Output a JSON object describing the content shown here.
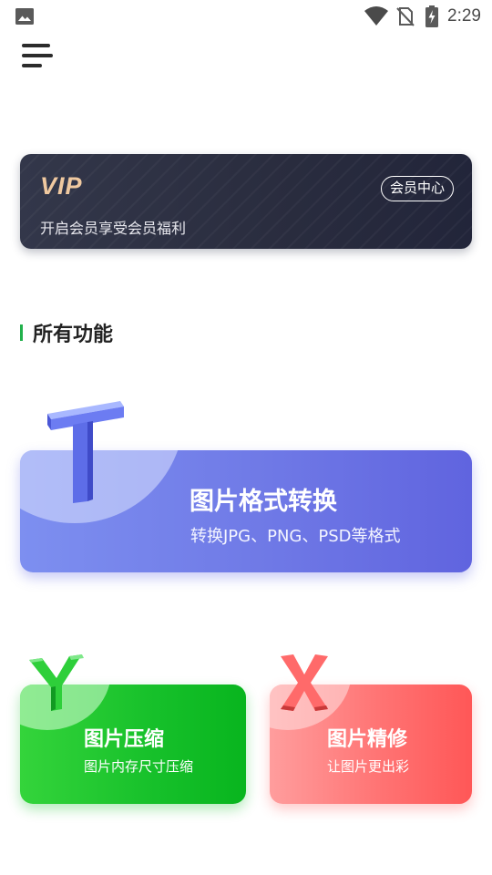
{
  "status_bar": {
    "time": "2:29",
    "icons": [
      "image-icon",
      "wifi-icon",
      "no-sim-icon",
      "battery-charging-icon"
    ]
  },
  "header": {
    "menu_icon": "menu-icon"
  },
  "vip": {
    "logo_text": "VIP",
    "subtitle": "开启会员享受会员福利",
    "center_button": "会员中心",
    "logo_color": "#f0c9a0"
  },
  "section": {
    "title": "所有功能",
    "accent_color": "#22b14c"
  },
  "features": {
    "format": {
      "letter": "T",
      "title": "图片格式转换",
      "subtitle": "转换JPG、PNG、PSD等格式",
      "color": "#6f79e6"
    },
    "compress": {
      "letter": "Y",
      "title": "图片压缩",
      "subtitle": "图片内存尺寸压缩",
      "color": "#16c02a"
    },
    "retouch": {
      "letter": "X",
      "title": "图片精修",
      "subtitle": "让图片更出彩",
      "color": "#ff6b6b"
    }
  }
}
